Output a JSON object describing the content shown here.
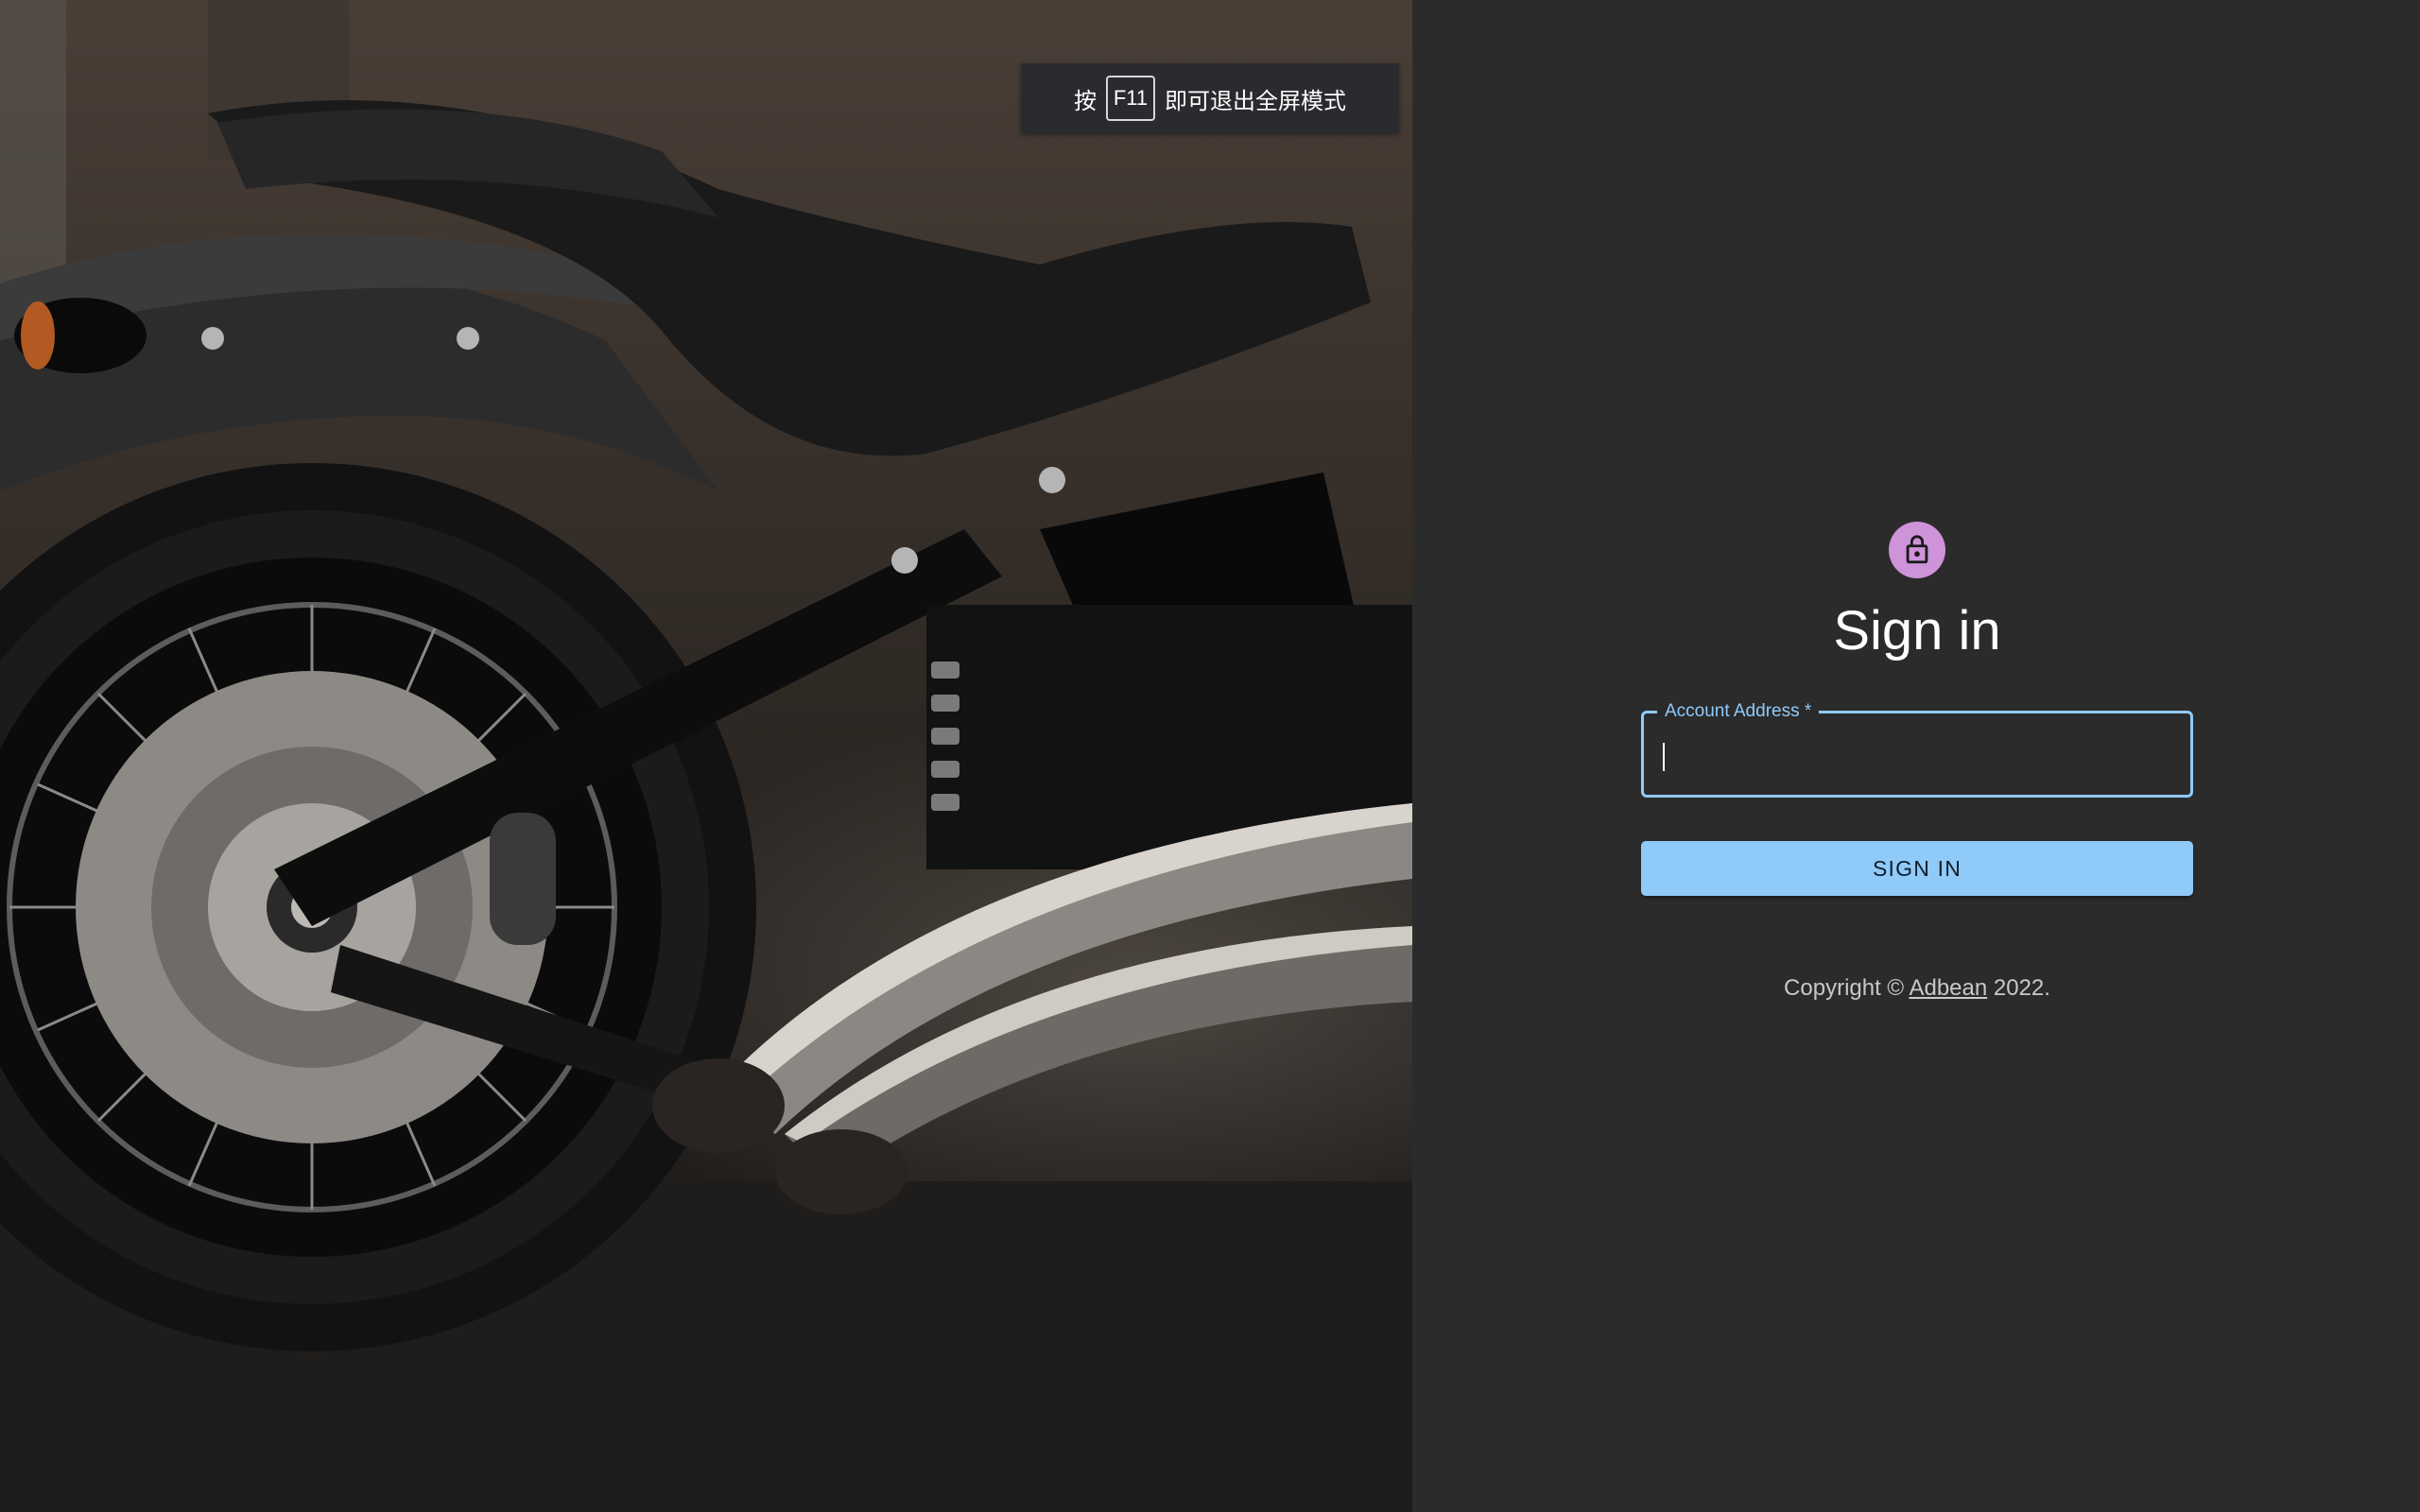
{
  "fullscreen_hint": {
    "prefix": "按",
    "key": "F11",
    "suffix": "即可退出全屏模式"
  },
  "hero": {
    "icon": "motorcycle-photo"
  },
  "login": {
    "lock_icon": "lock-icon",
    "title": "Sign in",
    "account_label": "Account Address *",
    "account_value": "",
    "button_label": "SIGN IN",
    "copyright_prefix": "Copyright ©",
    "copyright_link": "Adbean",
    "copyright_suffix": "2022."
  },
  "colors": {
    "accent": "#90caf9",
    "avatar": "#ce93d8",
    "panel_bg": "#2b2b2b"
  }
}
